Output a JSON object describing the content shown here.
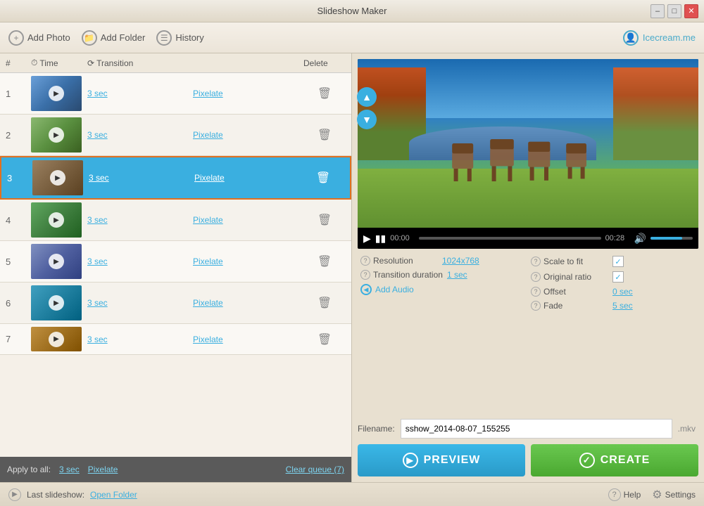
{
  "window": {
    "title": "Slideshow Maker",
    "controls": [
      "minimize",
      "restore",
      "close"
    ]
  },
  "toolbar": {
    "add_photo_label": "Add Photo",
    "add_folder_label": "Add Folder",
    "history_label": "History",
    "brand_label": "Icecream.me"
  },
  "table": {
    "col_num": "#",
    "col_time": "Time",
    "col_transition": "Transition",
    "col_delete": "Delete"
  },
  "slides": [
    {
      "num": 1,
      "time": "3 sec",
      "transition": "Pixelate",
      "thumb_class": "thumb-1",
      "selected": false
    },
    {
      "num": 2,
      "time": "3 sec",
      "transition": "Pixelate",
      "thumb_class": "thumb-2",
      "selected": false
    },
    {
      "num": 3,
      "time": "3 sec",
      "transition": "Pixelate",
      "thumb_class": "thumb-3",
      "selected": true
    },
    {
      "num": 4,
      "time": "3 sec",
      "transition": "Pixelate",
      "thumb_class": "thumb-4",
      "selected": false
    },
    {
      "num": 5,
      "time": "3 sec",
      "transition": "Pixelate",
      "thumb_class": "thumb-5",
      "selected": false
    },
    {
      "num": 6,
      "time": "3 sec",
      "transition": "Pixelate",
      "thumb_class": "thumb-6",
      "selected": false
    },
    {
      "num": 7,
      "time": "3 sec",
      "transition": "Pixelate",
      "thumb_class": "thumb-7",
      "selected": false
    }
  ],
  "apply_bar": {
    "label": "Apply to all:",
    "time": "3 sec",
    "transition": "Pixelate",
    "clear_label": "Clear queue (7)"
  },
  "video": {
    "time_current": "00:00",
    "time_total": "00:28"
  },
  "settings": {
    "resolution_label": "Resolution",
    "resolution_value": "1024x768",
    "transition_duration_label": "Transition duration",
    "transition_duration_value": "1 sec",
    "scale_to_fit_label": "Scale to fit",
    "original_ratio_label": "Original ratio",
    "offset_label": "Offset",
    "offset_value": "0 sec",
    "fade_label": "Fade",
    "fade_value": "5 sec",
    "add_audio_label": "Add Audio"
  },
  "filename": {
    "label": "Filename:",
    "value": "sshow_2014-08-07_155255",
    "extension": ".mkv"
  },
  "buttons": {
    "preview_label": "PREVIEW",
    "create_label": "CREATE"
  },
  "status_bar": {
    "label": "Last slideshow:",
    "link": "Open Folder",
    "help_label": "Help",
    "settings_label": "Settings"
  }
}
